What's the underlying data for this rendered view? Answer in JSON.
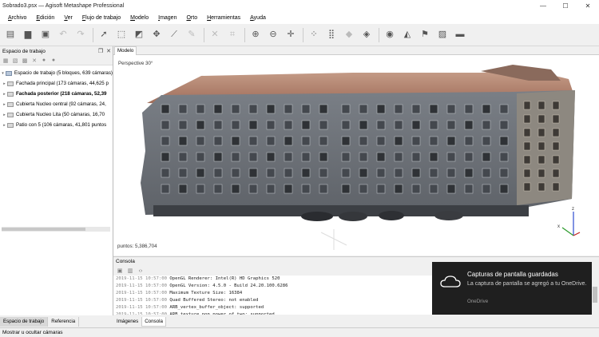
{
  "app": {
    "window_title": "Sobrado3.psx — Agisoft Metashape Professional",
    "min_glyph": "—",
    "max_glyph": "☐",
    "close_glyph": "✕"
  },
  "menu": [
    "Archivo",
    "Edición",
    "Ver",
    "Flujo de trabajo",
    "Modelo",
    "Imagen",
    "Orto",
    "Herramientas",
    "Ayuda"
  ],
  "toolbar": {
    "icons": [
      {
        "name": "new-icon",
        "glyph": "▤"
      },
      {
        "name": "open-icon",
        "glyph": "▆"
      },
      {
        "name": "save-icon",
        "glyph": "▣"
      },
      {
        "name": "undo-icon",
        "glyph": "↶",
        "dim": true
      },
      {
        "name": "redo-icon",
        "glyph": "↷",
        "dim": true
      },
      {
        "sep": true
      },
      {
        "name": "navigation-icon",
        "glyph": "➚"
      },
      {
        "name": "rectangle-selection-icon",
        "glyph": "⬚"
      },
      {
        "name": "resize-region-icon",
        "glyph": "◩"
      },
      {
        "name": "move-region-icon",
        "glyph": "✥"
      },
      {
        "name": "ruler-icon",
        "glyph": "⟋"
      },
      {
        "name": "draw-icon",
        "glyph": "✎",
        "dim": true
      },
      {
        "sep": true
      },
      {
        "name": "delete-icon",
        "glyph": "✕",
        "dim": true
      },
      {
        "name": "crop-icon",
        "glyph": "⌗",
        "dim": true
      },
      {
        "sep": true
      },
      {
        "name": "zoom-in-icon",
        "glyph": "⊕"
      },
      {
        "name": "zoom-out-icon",
        "glyph": "⊖"
      },
      {
        "name": "reset-view-icon",
        "glyph": "✛"
      },
      {
        "sep": true
      },
      {
        "name": "point-cloud-icon",
        "glyph": "⁘"
      },
      {
        "name": "dense-cloud-icon",
        "glyph": "⣿"
      },
      {
        "name": "mesh-icon",
        "glyph": "◆",
        "dim": true
      },
      {
        "name": "tiled-model-icon",
        "glyph": "◈"
      },
      {
        "sep": true
      },
      {
        "name": "camera-icon",
        "glyph": "◉"
      },
      {
        "name": "shape-icon",
        "glyph": "◭"
      },
      {
        "name": "flag-icon",
        "glyph": "⚑"
      },
      {
        "name": "image-icon",
        "glyph": "▨"
      },
      {
        "name": "disk-icon",
        "glyph": "▬"
      }
    ]
  },
  "workspace": {
    "title": "Espacio de trabajo",
    "float_glyph": "❐",
    "close_glyph": "✕",
    "root": "Espacio de trabajo (5 bloques, 639 cámaras)",
    "chunks": [
      {
        "label": "Fachada principal (173 cámaras, 44,625 p",
        "bold": false
      },
      {
        "label": "Fachada posterior (218 cámaras, 52,39",
        "bold": true
      },
      {
        "label": "Cubierta Nucleo central (92 cámaras, 24,",
        "bold": false
      },
      {
        "label": "Cubierta Nucleo Lita (50 cámaras, 16,70",
        "bold": false
      },
      {
        "label": "Patio con 5 (106 cámaras, 41,801 puntos",
        "bold": false
      }
    ],
    "scroll_fraction": 0.77
  },
  "left_tabs": [
    "Espacio de trabajo",
    "Referencia"
  ],
  "model": {
    "tab": "Modelo",
    "perspective": "Perspective 30°",
    "points": "puntos: 5,386,704",
    "axis_x": "x",
    "axis_z": "z"
  },
  "console": {
    "title": "Consola",
    "float_glyph": "❐",
    "close_glyph": "✕",
    "lines": [
      {
        "ts": "2019-11-15 10:57:00",
        "msg": "OpenGL Renderer: Intel(R) HD Graphics 520"
      },
      {
        "ts": "2019-11-15 10:57:00",
        "msg": "OpenGL Version: 4.5.0 - Build 24.20.100.6286"
      },
      {
        "ts": "2019-11-15 10:57:00",
        "msg": "Maximum Texture Size: 16384"
      },
      {
        "ts": "2019-11-15 10:57:00",
        "msg": "Quad Buffered Stereo: not enabled"
      },
      {
        "ts": "2019-11-15 10:57:00",
        "msg": "ARB_vertex_buffer_object: supported"
      },
      {
        "ts": "2019-11-15 10:57:00",
        "msg": "ARB_texture_non_power_of_two: supported"
      }
    ]
  },
  "bottom_tabs": [
    "Imágenes",
    "Consola"
  ],
  "status": "Mostrar u ocultar cámaras",
  "toast": {
    "title": "Capturas de pantalla guardadas",
    "message": "La captura de pantalla se agregó a tu OneDrive.",
    "footer": "OneDrive"
  }
}
